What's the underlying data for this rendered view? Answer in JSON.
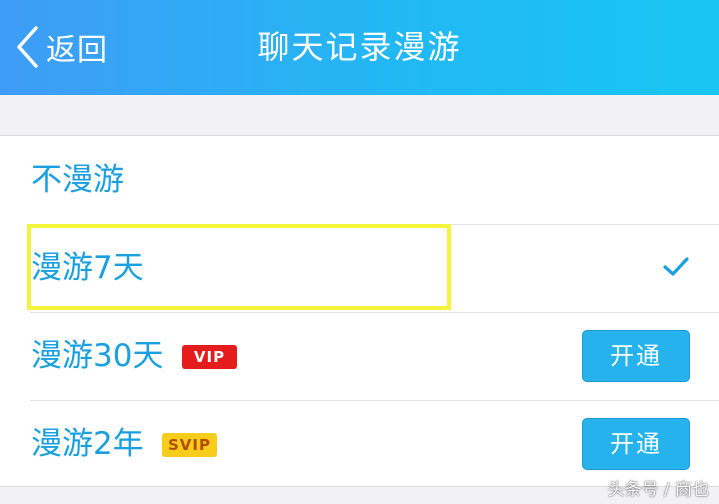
{
  "header": {
    "back_label": "返回",
    "title": "聊天记录漫游"
  },
  "options": [
    {
      "label": "不漫游",
      "selected": false
    },
    {
      "label": "漫游7天",
      "selected": true
    },
    {
      "label": "漫游30天",
      "badge": "VIP",
      "button": "开通"
    },
    {
      "label": "漫游2年",
      "badge": "SVIP",
      "button": "开通"
    }
  ],
  "icons": {
    "back": "chevron-left-icon",
    "check": "checkmark-icon"
  },
  "colors": {
    "header_start": "#3f9cf6",
    "header_end": "#19c6f3",
    "label_text": "#1aa0e0",
    "button_bg": "#26b3ed",
    "vip_badge": "#e51c1c",
    "svip_badge": "#f7cd1c",
    "highlight_box": "#f4f43a"
  },
  "watermark": "头条号 / 商也"
}
